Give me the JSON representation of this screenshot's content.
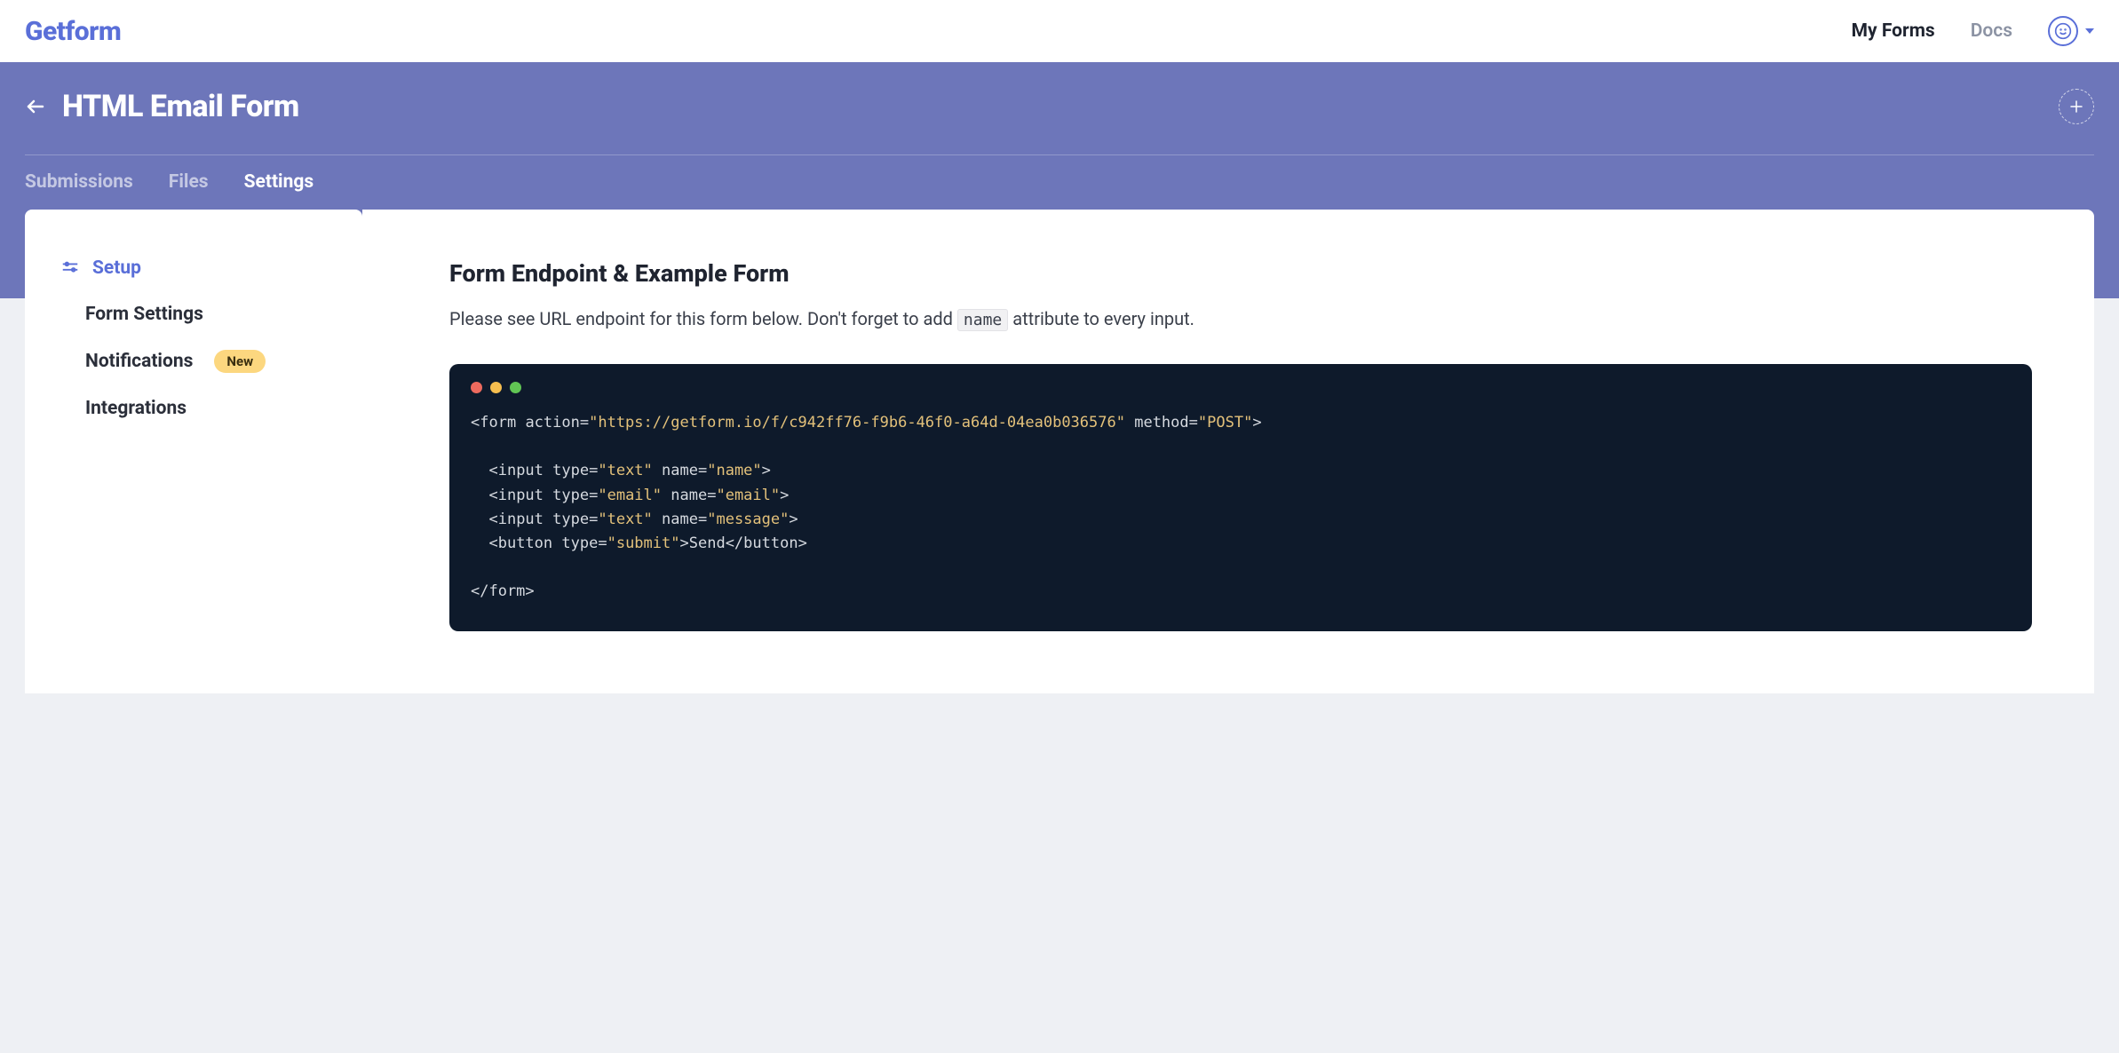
{
  "brand": "Getform",
  "topnav": {
    "my_forms": "My Forms",
    "docs": "Docs"
  },
  "header": {
    "title": "HTML Email Form",
    "tabs": {
      "submissions": "Submissions",
      "files": "Files",
      "settings": "Settings"
    },
    "active_tab": "settings"
  },
  "sidebar": {
    "setup": "Setup",
    "form_settings": "Form Settings",
    "notifications": "Notifications",
    "notifications_badge": "New",
    "integrations": "Integrations",
    "active_item": "setup"
  },
  "main": {
    "title": "Form Endpoint & Example Form",
    "desc_before": "Please see URL endpoint for this form below. Don't forget to add ",
    "desc_code": "name",
    "desc_after": " attribute to every input.",
    "code": {
      "action_url": "https://getform.io/f/c942ff76-f9b6-46f0-a64d-04ea0b036576",
      "method": "POST",
      "inputs": [
        {
          "type": "text",
          "name": "name"
        },
        {
          "type": "email",
          "name": "email"
        },
        {
          "type": "text",
          "name": "message"
        }
      ],
      "button_type": "submit",
      "button_text": "Send"
    }
  }
}
